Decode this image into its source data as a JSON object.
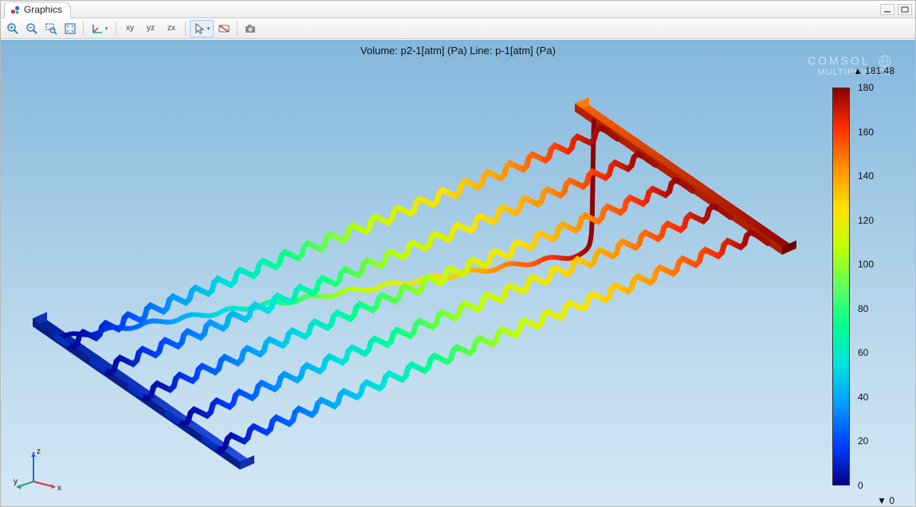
{
  "window": {
    "title": "Graphics",
    "minimize_tooltip": "Minimize",
    "maximize_tooltip": "Maximize"
  },
  "toolbar": {
    "zoom_in": "Zoom In",
    "zoom_out": "Zoom Out",
    "zoom_box": "Zoom Box",
    "zoom_extents": "Zoom Extents",
    "orbit": "Rotate",
    "view_xy": "xy",
    "view_yz": "yz",
    "view_zx": "zx",
    "select": "Select",
    "hide": "Hide",
    "snapshot": "Snapshot"
  },
  "plot": {
    "title": "Volume: p2-1[atm] (Pa)  Line: p-1[atm] (Pa)"
  },
  "watermark": {
    "line1": "Comsol",
    "line2": "Multiphysics"
  },
  "colorbar": {
    "max_marker": "▲",
    "max_value": "181.48",
    "min_marker": "▼",
    "min_value": "0",
    "ticks": [
      "180",
      "160",
      "140",
      "120",
      "100",
      "80",
      "60",
      "40",
      "20",
      "0"
    ]
  },
  "triad": {
    "x_label": "x",
    "y_label": "y",
    "z_label": "z"
  },
  "chart_data": {
    "type": "heatmap",
    "title": "Volume: p2-1[atm] (Pa)  Line: p-1[atm] (Pa)",
    "colorbar_label": "",
    "min": 0,
    "max": 181.48,
    "ticks": [
      0,
      20,
      40,
      60,
      80,
      100,
      120,
      140,
      160,
      180
    ],
    "description": "3D isometric view of a serpentine microchannel manifold. Left manifold (inlet) at low pressure ≈0 Pa (dark blue); right manifold (outlet) at high pressure ≈180 Pa (dark red). Five wavy parallel channels connect them, with pressure increasing approximately linearly left→right along each channel following the rainbow colormap.",
    "channels": 5,
    "inlet_pressure_Pa": 0,
    "outlet_pressure_Pa": 181.48
  }
}
